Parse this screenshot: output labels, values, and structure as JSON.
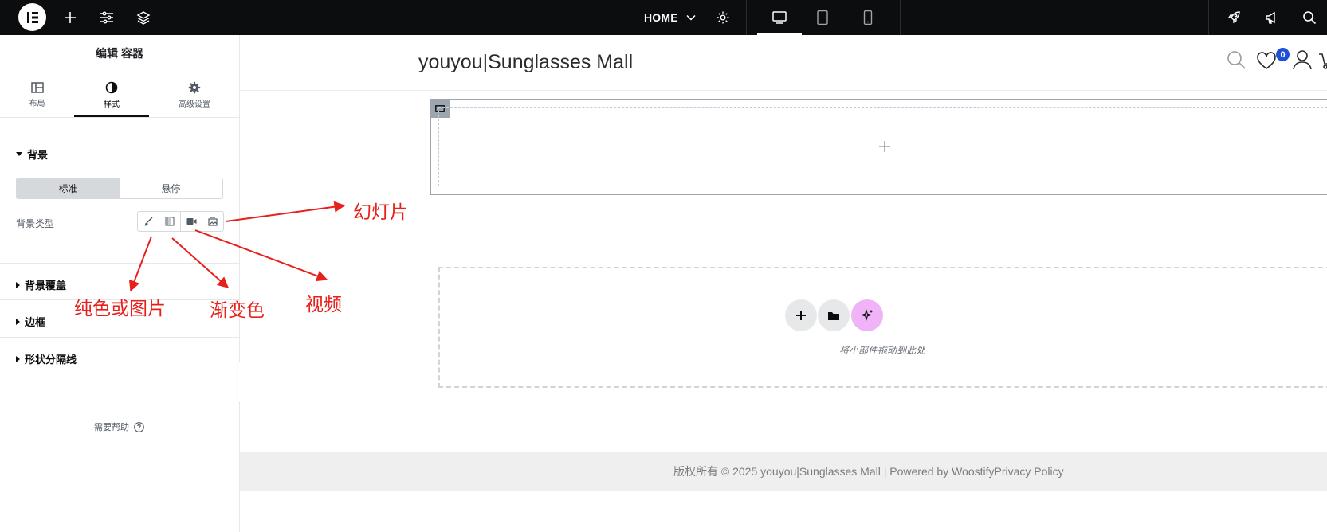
{
  "topbar": {
    "logo_icon": "elementor-logo-icon",
    "add_icon": "plus-icon",
    "settings_icon": "sliders-icon",
    "structure_icon": "layers-icon",
    "page_label": "HOME",
    "page_dropdown_icon": "chevron-down-icon",
    "page_settings_icon": "gear-icon",
    "devices": [
      "desktop-icon",
      "tablet-icon",
      "mobile-icon"
    ],
    "right_icons": [
      "rocket-icon",
      "megaphone-icon",
      "search-icon"
    ]
  },
  "panel": {
    "title": "编辑 容器",
    "tabs": [
      {
        "label": "布局",
        "icon": "layout-icon"
      },
      {
        "label": "样式",
        "icon": "contrast-icon",
        "active": true
      },
      {
        "label": "高级设置",
        "icon": "gear-icon"
      }
    ],
    "background": {
      "heading": "背景",
      "switch": [
        "标准",
        "悬停"
      ],
      "type_label": "背景类型",
      "type_icons": [
        "brush-icon",
        "gradient-icon",
        "video-icon",
        "slideshow-icon"
      ]
    },
    "sections": [
      "背景覆盖",
      "边框",
      "形状分隔线"
    ],
    "help": "需要帮助"
  },
  "canvas": {
    "site_title": "youyou|Sunglasses Mall",
    "wishlist_count": "0",
    "drop_text": "将小部件拖动到此处",
    "footer": "版权所有 © 2025 youyou|Sunglasses Mall | Powered by WoostifyPrivacy Policy"
  },
  "annotations": {
    "slideshow": "幻灯片",
    "solid_or_image": "纯色或图片",
    "gradient": "渐变色",
    "video": "视频",
    "color": "#e8201b"
  }
}
